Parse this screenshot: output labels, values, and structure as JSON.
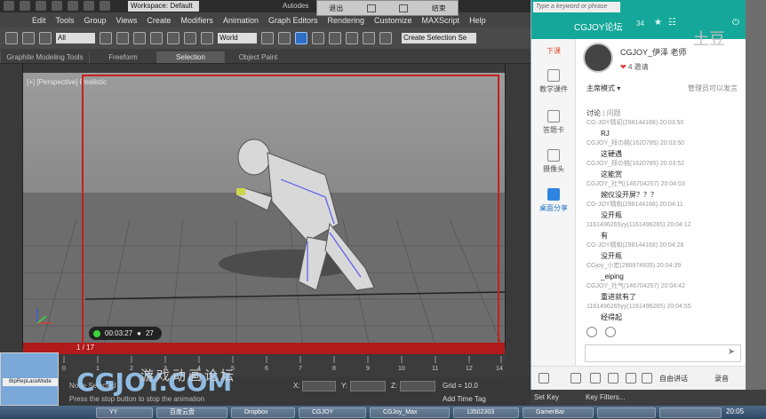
{
  "max": {
    "workspace": "Workspace: Default",
    "title": "Autodes",
    "menus": [
      "Edit",
      "Tools",
      "Group",
      "Views",
      "Create",
      "Modifiers",
      "Animation",
      "Graph Editors",
      "Rendering",
      "Customize",
      "MAXScript",
      "Help"
    ],
    "toolbar": {
      "filter": "All",
      "coord_system": "World",
      "selection_set": "Create Selection Se"
    },
    "ribbon_tabs": [
      "Graphite Modeling Tools",
      "Freeform",
      "Selection",
      "Object Paint"
    ],
    "viewport_label": "[+] [Perspective] Realistic",
    "recording": {
      "time": "00:03:27",
      "viewers": "27"
    },
    "timeline": {
      "frame": "1 / 17",
      "ticks": [
        "0",
        "1",
        "2",
        "3",
        "4",
        "5",
        "6",
        "7",
        "8",
        "9",
        "10",
        "11",
        "12",
        "14"
      ]
    },
    "status": {
      "selection": "None Selected",
      "prompt": "Press the stop button to stop the animation",
      "x_label": "X:",
      "y_label": "Y:",
      "z_label": "Z:",
      "grid": "Grid = 10.0",
      "add_time_tag": "Add Time Tag"
    },
    "logo_caption": "BipRepLaceMode",
    "keys": {
      "set_key": "Set Key",
      "key_filters": "Key Filters..."
    }
  },
  "remote_bar": {
    "exit": "退出",
    "end": "结束"
  },
  "watermark": {
    "brand": "CGJOY.COM",
    "slogan": "游戏动画论坛",
    "tudou": "土豆"
  },
  "chat": {
    "search_placeholder": "Type a keyword or phrase",
    "channel": "CGJOY论坛",
    "member_count": "34",
    "sidebar": [
      "下课",
      "教学课件",
      "答题卡",
      "摄像头",
      "桌面分享"
    ],
    "host": {
      "name": "CGJOY_伊泽 老师",
      "likes": "4",
      "invite": "邀请"
    },
    "mode": "主席模式 ▾",
    "admin_note": "管理员可以发言",
    "tabs": [
      "讨论",
      "问题"
    ],
    "messages": [
      {
        "head": "CG-JOY晴初(298144168) 20:03:50",
        "text": "RJ"
      },
      {
        "head": "CGJOY_拜の桃(1620785) 20:03:50",
        "text": "这硬遇"
      },
      {
        "head": "CGJOY_拜の桃(1620785) 20:03:52",
        "text": "这能赏"
      },
      {
        "head": "CGJOY_社气(146704257) 20:04:03",
        "text": "婉仪没开屏？？？"
      },
      {
        "head": "CG-JOY晴和(298144168) 20:04:11",
        "text": "没开瓶"
      },
      {
        "head": "1161496265yy(1161496265) 20:04:12",
        "text": "有"
      },
      {
        "head": "CG-JOY晴和(298144168) 20:04:26",
        "text": "没开瓶"
      },
      {
        "head": "CGjoy_小宏(280974935) 20:04:39",
        "text": "_eiping"
      },
      {
        "head": "CGJOY_社气(146704257) 20:04:42",
        "text": "重进就有了"
      },
      {
        "head": "1161496265yy(1161496265) 20:04:55",
        "text": "经得起"
      }
    ],
    "bottom": {
      "free_talk": "自由讲话",
      "record": "录音"
    }
  },
  "taskbar": {
    "items": [
      "YY",
      "百度云盘",
      "Dropbox",
      "CGJOY",
      "CGJoy_Max",
      "13502303",
      "GamerBar",
      "",
      ""
    ],
    "clock": "20:05"
  }
}
